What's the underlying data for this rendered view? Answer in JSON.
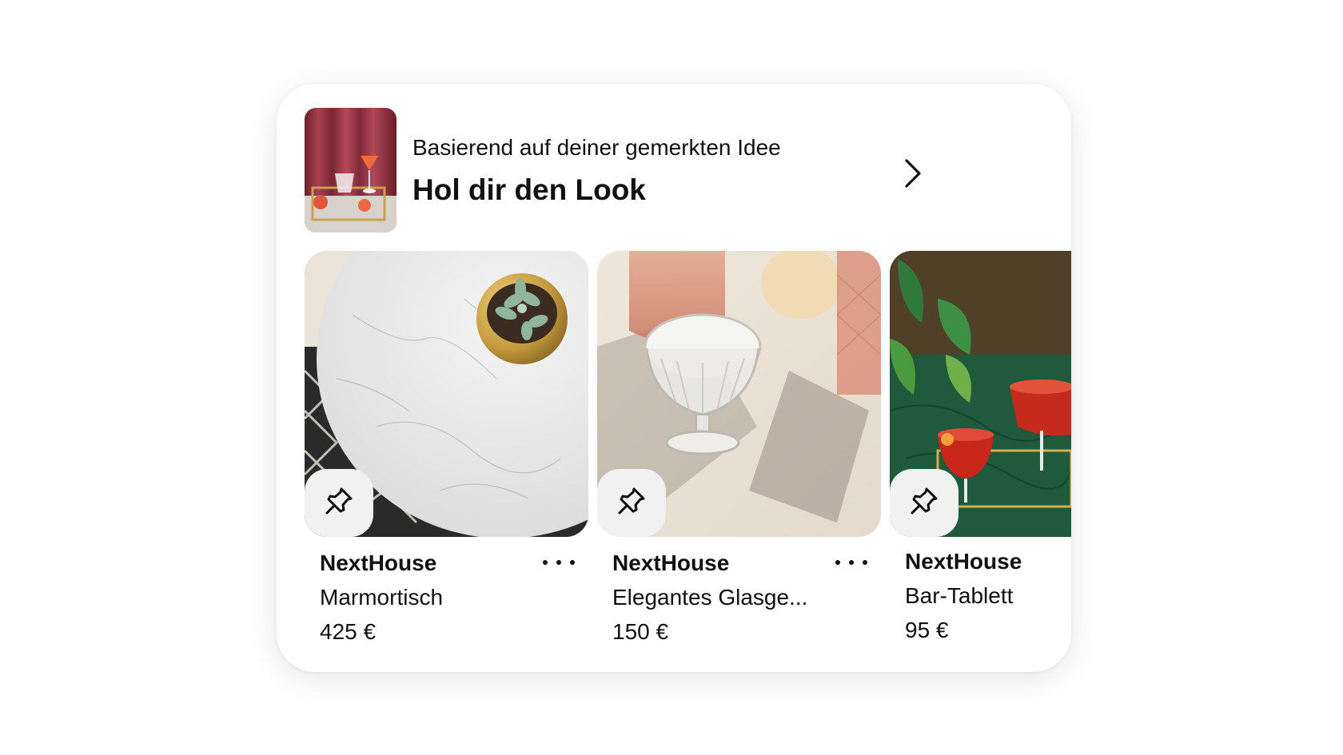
{
  "header": {
    "subtitle": "Basierend auf deiner gemerkten Idee",
    "title": "Hol dir den Look",
    "thumb_icon": "cocktail-tray-image",
    "chevron_icon": "chevron-right-icon"
  },
  "products": [
    {
      "brand": "NextHouse",
      "name": "Marmortisch",
      "price": "425 €",
      "image": "marble-table-with-succulent",
      "save_icon": "pin-icon",
      "more_icon": "more-options-icon"
    },
    {
      "brand": "NextHouse",
      "name": "Elegantes Glasge...",
      "price": "150 €",
      "image": "glass-coupe-and-tumblers",
      "save_icon": "pin-icon",
      "more_icon": "more-options-icon"
    },
    {
      "brand": "NextHouse",
      "name": "Bar-Tablett",
      "price": "95 €",
      "image": "cocktails-on-gold-tray-green-marble",
      "save_icon": "pin-icon"
    }
  ],
  "colors": {
    "card_background": "#ffffff",
    "text": "#111111",
    "pin_button_background": "#f1f1f1"
  }
}
